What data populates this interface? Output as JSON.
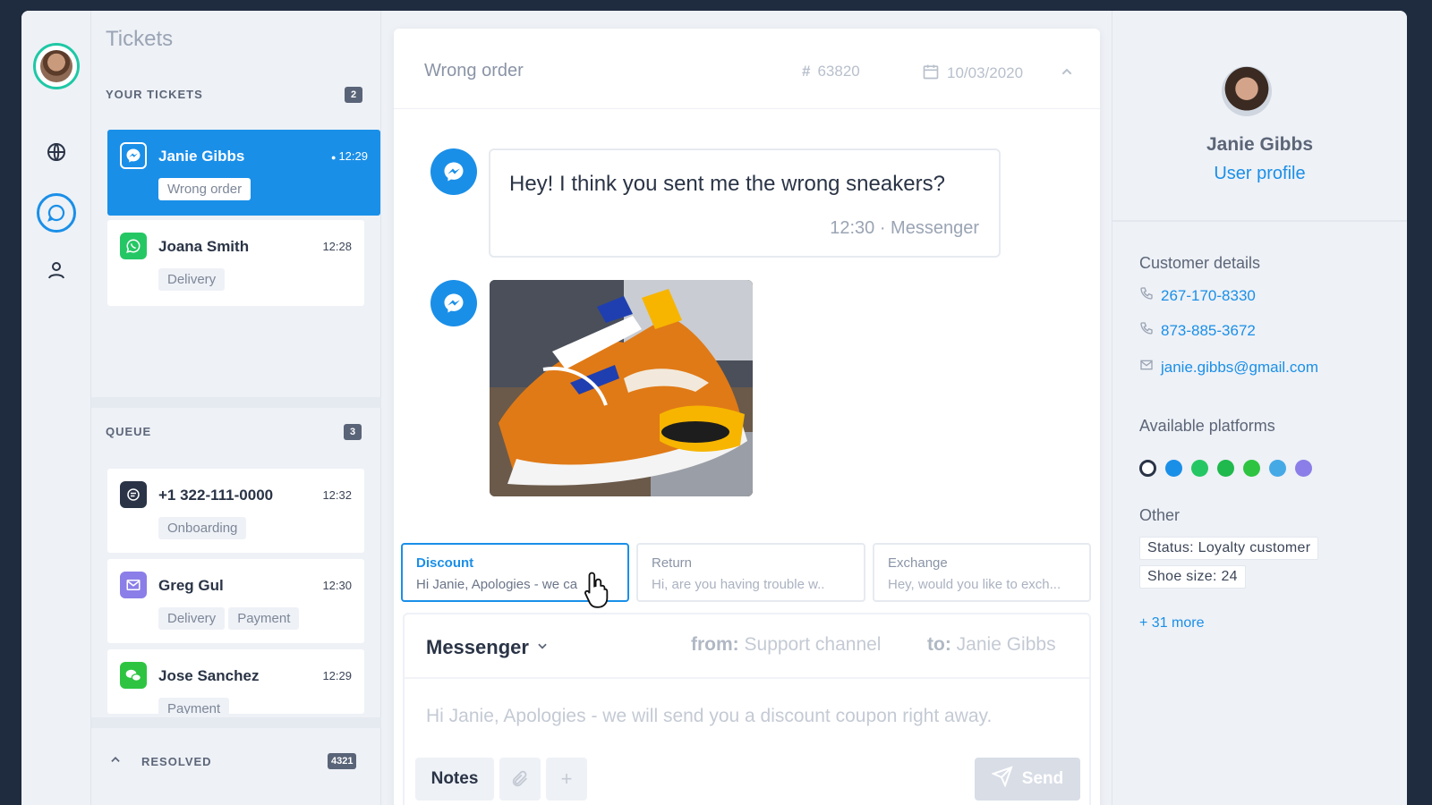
{
  "app": {
    "rail": {
      "icons": [
        "agent-avatar",
        "globe-icon",
        "chat-icon",
        "user-icon"
      ]
    },
    "tickets": {
      "title": "Tickets",
      "your_tickets_label": "YOUR TICKETS",
      "your_tickets_count": "2",
      "queue_label": "QUEUE",
      "queue_count": "3",
      "resolved_label": "RESOLVED",
      "resolved_count": "4321",
      "your_tickets": [
        {
          "name": "Janie Gibbs",
          "time": "12:29",
          "tags": [
            "Wrong order"
          ],
          "channel": "messenger-icon",
          "unread": true
        },
        {
          "name": "Joana Smith",
          "time": "12:28",
          "tags": [
            "Delivery"
          ],
          "channel": "whatsapp-icon"
        }
      ],
      "queue": [
        {
          "name": "+1 322-111-0000",
          "time": "12:32",
          "tags": [
            "Onboarding"
          ],
          "channel": "sms-icon"
        },
        {
          "name": "Greg Gul",
          "time": "12:30",
          "tags": [
            "Delivery",
            "Payment"
          ],
          "channel": "email-icon"
        },
        {
          "name": "Jose Sanchez",
          "time": "12:29",
          "tags": [
            "Payment"
          ],
          "channel": "wechat-icon"
        }
      ]
    },
    "conversation": {
      "subject": "Wrong order",
      "ticket_number": "63820",
      "date": "10/03/2020",
      "message_text": "Hey! I think you sent me the wrong sneakers?",
      "message_meta": "12:30 · Messenger",
      "suggestions": [
        {
          "title": "Discount",
          "preview": "Hi Janie, Apologies - we ca"
        },
        {
          "title": "Return",
          "preview": "Hi, are you having trouble w.."
        },
        {
          "title": "Exchange",
          "preview": "Hey, would you like to exch..."
        }
      ],
      "composer": {
        "channel": "Messenger",
        "from_label": "from:",
        "from_value": "Support channel",
        "to_label": "to:",
        "to_value": "Janie Gibbs",
        "draft": "Hi Janie, Apologies - we will send you a discount coupon right away.",
        "notes_label": "Notes",
        "send_label": "Send"
      }
    },
    "profile": {
      "name": "Janie Gibbs",
      "link": "User profile",
      "customer_details_label": "Customer details",
      "phone1": "267-170-8330",
      "phone2": "873-885-3672",
      "email": "janie.gibbs@gmail.com",
      "platforms_label": "Available platforms",
      "platforms": [
        {
          "name": "chat-icon",
          "color": "#2a3446"
        },
        {
          "name": "messenger-icon",
          "color": "#1a8fe8"
        },
        {
          "name": "whatsapp-icon",
          "color": "#25c764"
        },
        {
          "name": "line-icon",
          "color": "#1fb94d"
        },
        {
          "name": "wechat-icon",
          "color": "#2ec441"
        },
        {
          "name": "telegram-icon",
          "color": "#45a9e6"
        },
        {
          "name": "viber-icon",
          "color": "#8b7ee8"
        }
      ],
      "other_label": "Other",
      "status": "Status: Loyalty customer",
      "shoe_size": "Shoe size: 24",
      "more": "+ 31 more"
    },
    "colors": {
      "accent": "#1a8fe8",
      "rail_ring": "#1ec8a5",
      "background": "#1f2b3e"
    }
  }
}
